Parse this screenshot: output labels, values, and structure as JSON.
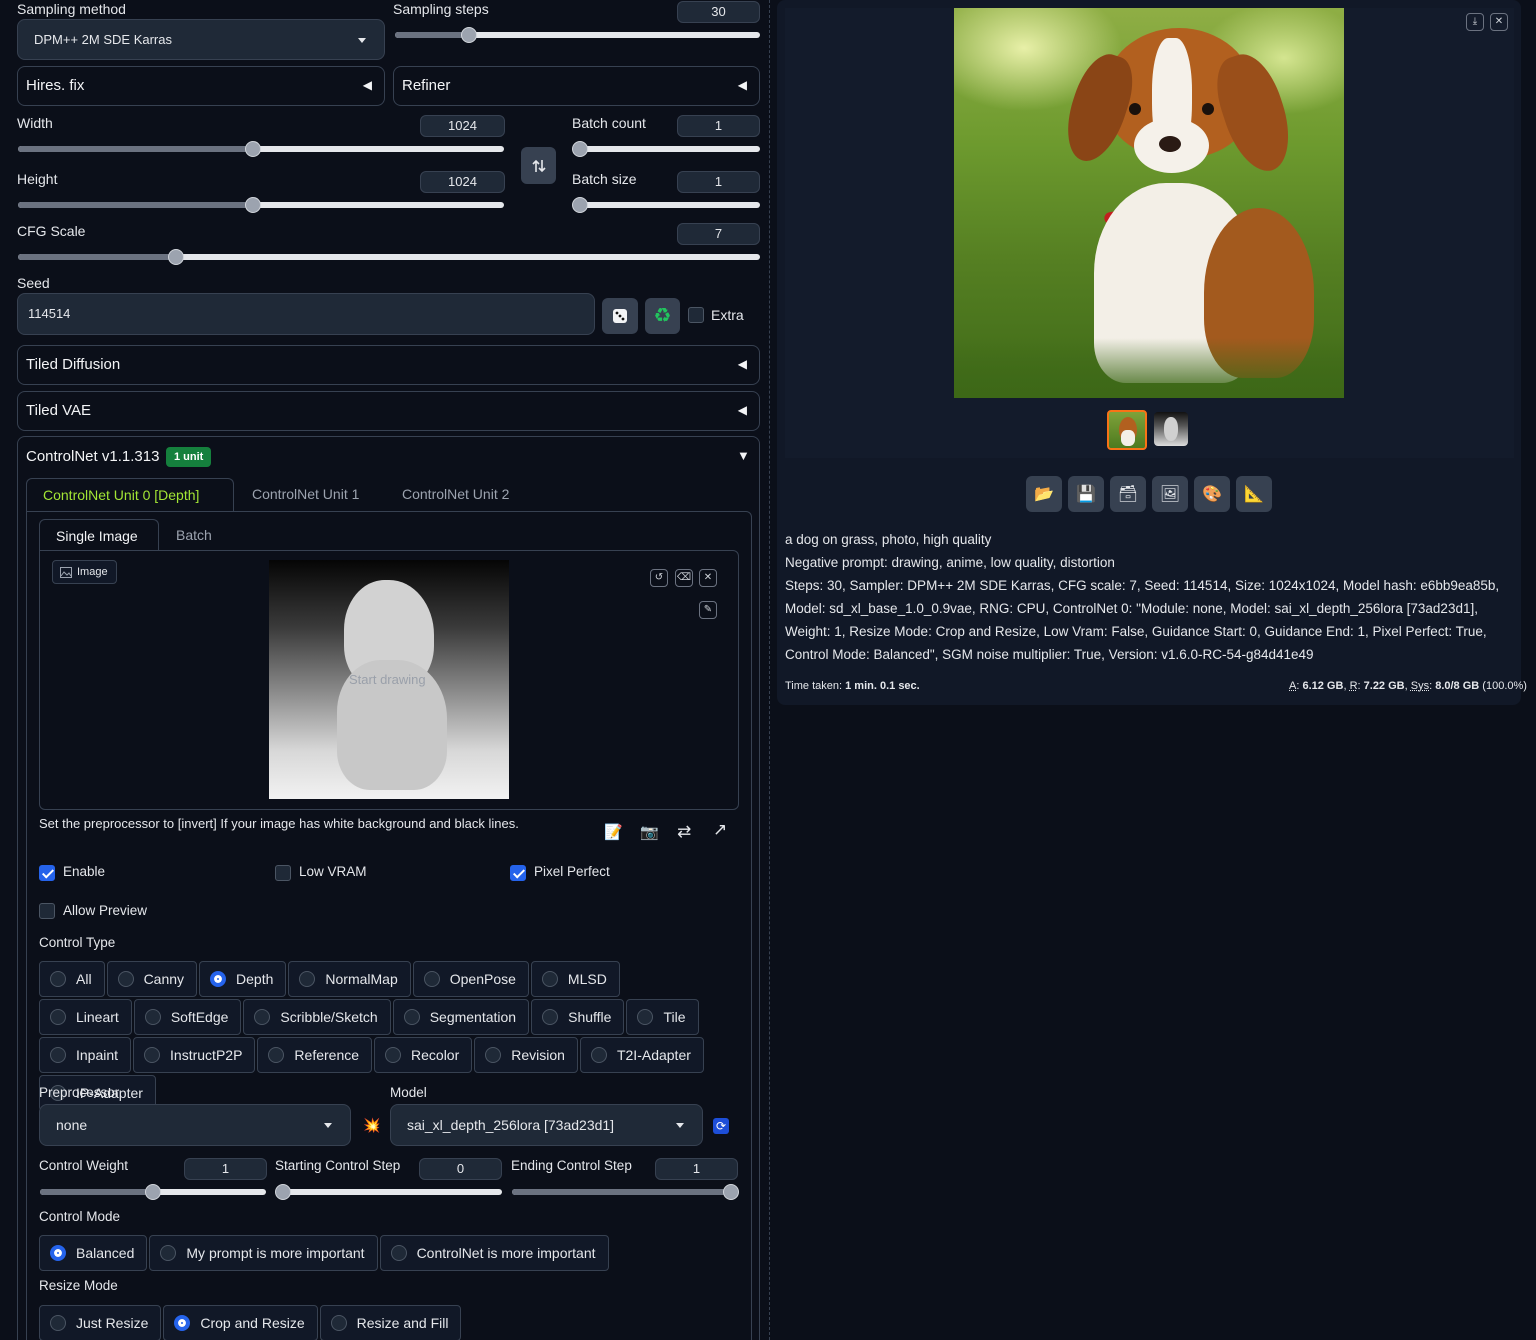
{
  "sampling": {
    "method_label": "Sampling method",
    "method_value": "DPM++ 2M SDE Karras",
    "steps_label": "Sampling steps",
    "steps_value": "30",
    "steps_fraction": 0.2
  },
  "accordions": {
    "hires": "Hires. fix",
    "refiner": "Refiner",
    "tiled_diffusion": "Tiled Diffusion",
    "tiled_vae": "Tiled VAE"
  },
  "size": {
    "width_label": "Width",
    "width_value": "1024",
    "height_label": "Height",
    "height_value": "1024",
    "swap_icon": "swap-vertical-icon"
  },
  "batch": {
    "count_label": "Batch count",
    "count_value": "1",
    "size_label": "Batch size",
    "size_value": "1"
  },
  "cfg": {
    "label": "CFG Scale",
    "value": "7"
  },
  "seed": {
    "label": "Seed",
    "value": "114514",
    "dice_icon": "dice-icon",
    "recycle_icon": "recycle-icon",
    "extra_label": "Extra"
  },
  "controlnet": {
    "title": "ControlNet v1.1.313",
    "badge": "1 unit",
    "tabs": [
      "ControlNet Unit 0 [Depth]",
      "ControlNet Unit 1",
      "ControlNet Unit 2"
    ],
    "subtabs": [
      "Single Image",
      "Batch"
    ],
    "image_label": "Image",
    "canvas_placeholder": "Start drawing",
    "hint": "Set the preprocessor to [invert] If your image has white background and black lines.",
    "enable_label": "Enable",
    "lowvram_label": "Low VRAM",
    "pixel_perfect_label": "Pixel Perfect",
    "allow_preview_label": "Allow Preview",
    "control_type_label": "Control Type",
    "control_types": [
      "All",
      "Canny",
      "Depth",
      "NormalMap",
      "OpenPose",
      "MLSD",
      "Lineart",
      "SoftEdge",
      "Scribble/Sketch",
      "Segmentation",
      "Shuffle",
      "Tile",
      "Inpaint",
      "InstructP2P",
      "Reference",
      "Recolor",
      "Revision",
      "T2I-Adapter",
      "IP-Adapter"
    ],
    "control_type_selected": "Depth",
    "preprocessor_label": "Preprocessor",
    "preprocessor_value": "none",
    "model_label": "Model",
    "model_value": "sai_xl_depth_256lora [73ad23d1]",
    "weight_label": "Control Weight",
    "weight_value": "1",
    "start_label": "Starting Control Step",
    "start_value": "0",
    "end_label": "Ending Control Step",
    "end_value": "1",
    "control_mode_label": "Control Mode",
    "control_modes": [
      "Balanced",
      "My prompt is more important",
      "ControlNet is more important"
    ],
    "control_mode_selected": "Balanced",
    "resize_mode_label": "Resize Mode",
    "resize_modes": [
      "Just Resize",
      "Crop and Resize",
      "Resize and Fill"
    ],
    "resize_mode_selected": "Crop and Resize"
  },
  "output": {
    "toolbar_icons": [
      "folder-icon",
      "save-icon",
      "zip-icon",
      "send-to-img2img-icon",
      "send-to-inpaint-icon",
      "send-to-extras-icon"
    ],
    "prompt": "a dog on grass, photo, high quality",
    "negative": "Negative prompt: drawing, anime, low quality, distortion",
    "params": "Steps: 30, Sampler: DPM++ 2M SDE Karras, CFG scale: 7, Seed: 114514, Size: 1024x1024, Model hash: e6bb9ea85b, Model: sd_xl_base_1.0_0.9vae, RNG: CPU, ControlNet 0: \"Module: none, Model: sai_xl_depth_256lora [73ad23d1], Weight: 1, Resize Mode: Crop and Resize, Low Vram: False, Guidance Start: 0, Guidance End: 1, Pixel Perfect: True, Control Mode: Balanced\", SGM noise multiplier: True, Version: v1.6.0-RC-54-g84d41e49",
    "time_prefix": "Time taken: ",
    "time_value": "1 min. 0.1 sec.",
    "vram_a_label": "A",
    "vram_a": "6.12 GB",
    "vram_r_label": "R",
    "vram_r": "7.22 GB",
    "vram_sys_label": "Sys",
    "vram_sys": "8.0/8 GB",
    "vram_pct": "(100.0%)"
  },
  "colors": {
    "background": "#0b0f19",
    "accent_blue": "#2563eb",
    "badge_green": "#15803d",
    "active_tab": "#a3e635",
    "thumbnail_border": "#f97316"
  }
}
